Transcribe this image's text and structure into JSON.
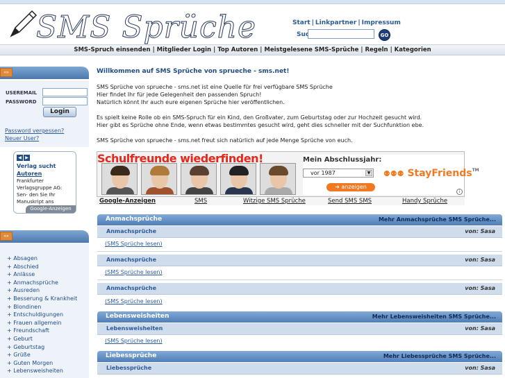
{
  "logo": {
    "text": "SMS Sprüche"
  },
  "toplinks": [
    "Start",
    "Linkpartner",
    "Impressum"
  ],
  "search": {
    "label": "Suc",
    "placeholder": "",
    "button": "GO"
  },
  "navbar": [
    "SMS-Spruch einsenden",
    "Mitglieder Login",
    "Top Autoren",
    "Meistgelesene SMS-Sprüche",
    "Regeln",
    "Kategorien"
  ],
  "login": {
    "user_label": "USEREMAIL",
    "pass_label": "PASSWORD",
    "button": "Login"
  },
  "sidebar_links": [
    "Password vergessen?",
    "Neuer User?"
  ],
  "sidebar_ad": {
    "title_line1": "Verlag sucht",
    "title_line2": "Autoren",
    "body": [
      "Frankfurter",
      "Verlagsgruppe AG:",
      "Sen- den Sie Ihr",
      "Manuskript ans"
    ],
    "badge": "Google-Anzeigen"
  },
  "categories": [
    "Absagen",
    "Abschied",
    "Anlässe",
    "Anmachsprüche",
    "Ausreden",
    "Besserung & Krankheit",
    "Blondinen",
    "Entschuldigungen",
    "Frauen allgemein",
    "Freundschaft",
    "Geburt",
    "Geburtstag",
    "Grüße",
    "Guten Morgen",
    "Lebensweisheiten"
  ],
  "welcome": "Willkommen auf SMS Sprüche von sprueche - sms.net!",
  "intro": [
    "SMS Sprüche von sprueche - sms.net ist eine Quelle für frei verfügbare SMS Sprüche",
    "Hier findet Ihr für jede Gelegenheit den passenden Spruch!",
    "Natürlich könnt Ihr auch eure eigenen Sprüche hier veröffentlichen.",
    "Es spielt keine Rolle ob ein SMS-Spruch für ein Kind, den Großvater, zum Geburtstag oder zur Hochzeit gesucht wird.",
    "Hier gibt es Sprüche ohne Ende, wenn etwas bestimmtes gesucht wird, geht dies schneller mit der Suchfunktion ebe.",
    "SMS Sprüche von sprueche - sms.net freut sich natürlich auf jede Menge Sprüche von euch."
  ],
  "banner": {
    "title": "Schulfreunde wiederfinden!",
    "abs_label": "Mein Abschlussjahr:",
    "abs_value": "vor 1987",
    "button": "anzeigen",
    "brand": "StayFriends",
    "tm": "TM"
  },
  "ad_links": [
    "Google-Anzeigen",
    "SMS",
    "Witzige SMS Sprüche",
    "Send SMS SMS",
    "Handy Sprüche"
  ],
  "sections": [
    {
      "title": "Anmachsprüche",
      "more": "Mehr Anmachsprüche SMS Sprüche...",
      "entries": [
        {
          "title": "Anmachsprüche",
          "author": "von: Sasa",
          "read": "(SMS Sprüche lesen)"
        },
        {
          "title": "Anmachsprüche",
          "author": "von: Sasa",
          "read": "(SMS Sprüche lesen)"
        },
        {
          "title": "Anmachsprüche",
          "author": "von: Sasa",
          "read": "(SMS Sprüche lesen)"
        }
      ]
    },
    {
      "title": "Lebensweisheiten",
      "more": "Mehr Lebensweisheiten SMS Sprüche...",
      "entries": [
        {
          "title": "Lebensweisheiten",
          "author": "von: Sasa",
          "read": "(SMS Sprüche lesen)"
        }
      ]
    },
    {
      "title": "Liebessprüche",
      "more": "Mehr Liebessprüche SMS Sprüche...",
      "entries": [
        {
          "title": "Liebessprüche",
          "author": "von: Sasa",
          "read": ""
        }
      ]
    }
  ],
  "colors": {
    "accent": "#1f4c86",
    "header_blue": "#4f7eb7",
    "orange": "#f07a22"
  }
}
